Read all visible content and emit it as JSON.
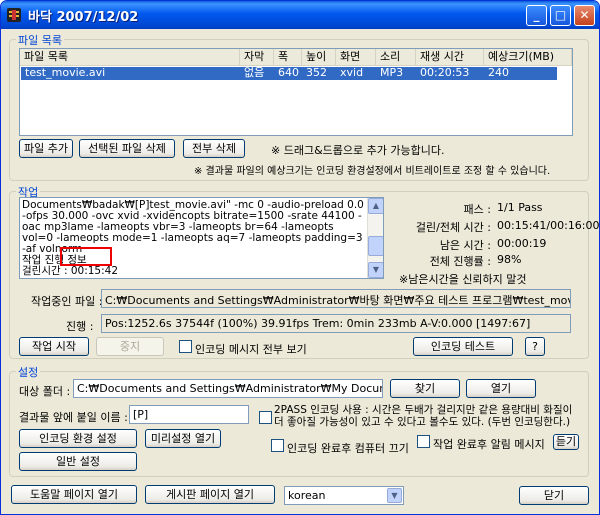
{
  "window": {
    "title": "바닥 2007/12/02"
  },
  "file_section": {
    "title": "파일 목록",
    "columns": [
      "파일 목록",
      "자막",
      "폭",
      "높이",
      "화면",
      "소리",
      "재생 시간",
      "예상크기(MB)"
    ],
    "rows": [
      {
        "name": "test_movie.avi",
        "subtitle": "없음",
        "width": "640",
        "height": "352",
        "video": "xvid",
        "audio": "MP3",
        "duration": "00:20:53",
        "size": "240"
      }
    ],
    "add_file_label": "파일 추가",
    "delete_selected_label": "선택된 파일 삭제",
    "delete_all_label": "전부 삭제",
    "note_drag": "※ 드래그&드롭으로 추가 가능합니다.",
    "note_size": "※ 결과물 파일의 예상크기는 인코딩 환경설정에서 비트레이트로 조정 할 수 있습니다."
  },
  "work_section": {
    "title": "작업",
    "log": "Documents₩badak₩[P]test_movie.avi\" -mc 0 -audio-preload 0.0 -ofps 30.000 -ovc xvid -xvidencopts bitrate=1500 -srate 44100 -oac mp3lame -lameopts vbr=3 -lameopts br=64 -lameopts vol=0 -lameopts mode=1 -lameopts aq=7 -lameopts padding=3 -af volnorm\n작업 진행 정보\n걸린시간 : 00:15:42",
    "stats": [
      {
        "label": "패스 :",
        "value": "1/1 Pass"
      },
      {
        "label": "걸린/전체 시간 :",
        "value": "00:15:41/00:16:00"
      },
      {
        "label": "남은 시간 :",
        "value": "00:00:19"
      },
      {
        "label": "전체 진행률 :",
        "value": "98%"
      }
    ],
    "note": "※남은시간을 신뢰하지 말것",
    "current_file_label": "작업중인 파일 :",
    "current_file": "C:₩Documents and Settings₩Administrator₩바탕 화면₩주요 테스트 프로그램₩test_movie.avi",
    "progress_label": "진행 :",
    "progress": "Pos:1252.6s  37544f (100%) 39.91fps Trem:   0min 233mb  A-V:0.000 [1497:67]",
    "start_label": "작업 시작",
    "stop_label": "중지",
    "show_all_label": "인코딩 메시지 전부 보기",
    "encode_test_label": "인코딩 테스트",
    "help_label": "?"
  },
  "settings_section": {
    "title": "설정",
    "target_folder_label": "대상 폴더 :",
    "target_folder": "C:₩Documents and Settings₩Administrator₩My Documents₩bada",
    "browse_label": "찾기",
    "open_label": "열기",
    "prefix_label": "결과물 앞에 붙일 이름 :",
    "prefix_value": "[P]",
    "twopass_label": "2PASS 인코딩 사용 : 시간은 두배가 걸리지만 같은 용량대비 화질이 더 좋아질 가능성이 있고 수 있다고 볼수도 있다. (두번 인코딩한다.)",
    "encode_settings_label": "인코딩 환경 설정",
    "preset_open_label": "미리설정 열기",
    "general_settings_label": "일반 설정",
    "shutdown_label": "인코딩 완료후 컴퓨터 끄기",
    "notify_label": "작업 완료후 알림 메시지",
    "notify_button_label": "듣기"
  },
  "footer": {
    "help_open_label": "도움말 페이지 열기",
    "board_open_label": "게시판 페이지 열기",
    "language": "korean",
    "close_label": "닫기"
  }
}
